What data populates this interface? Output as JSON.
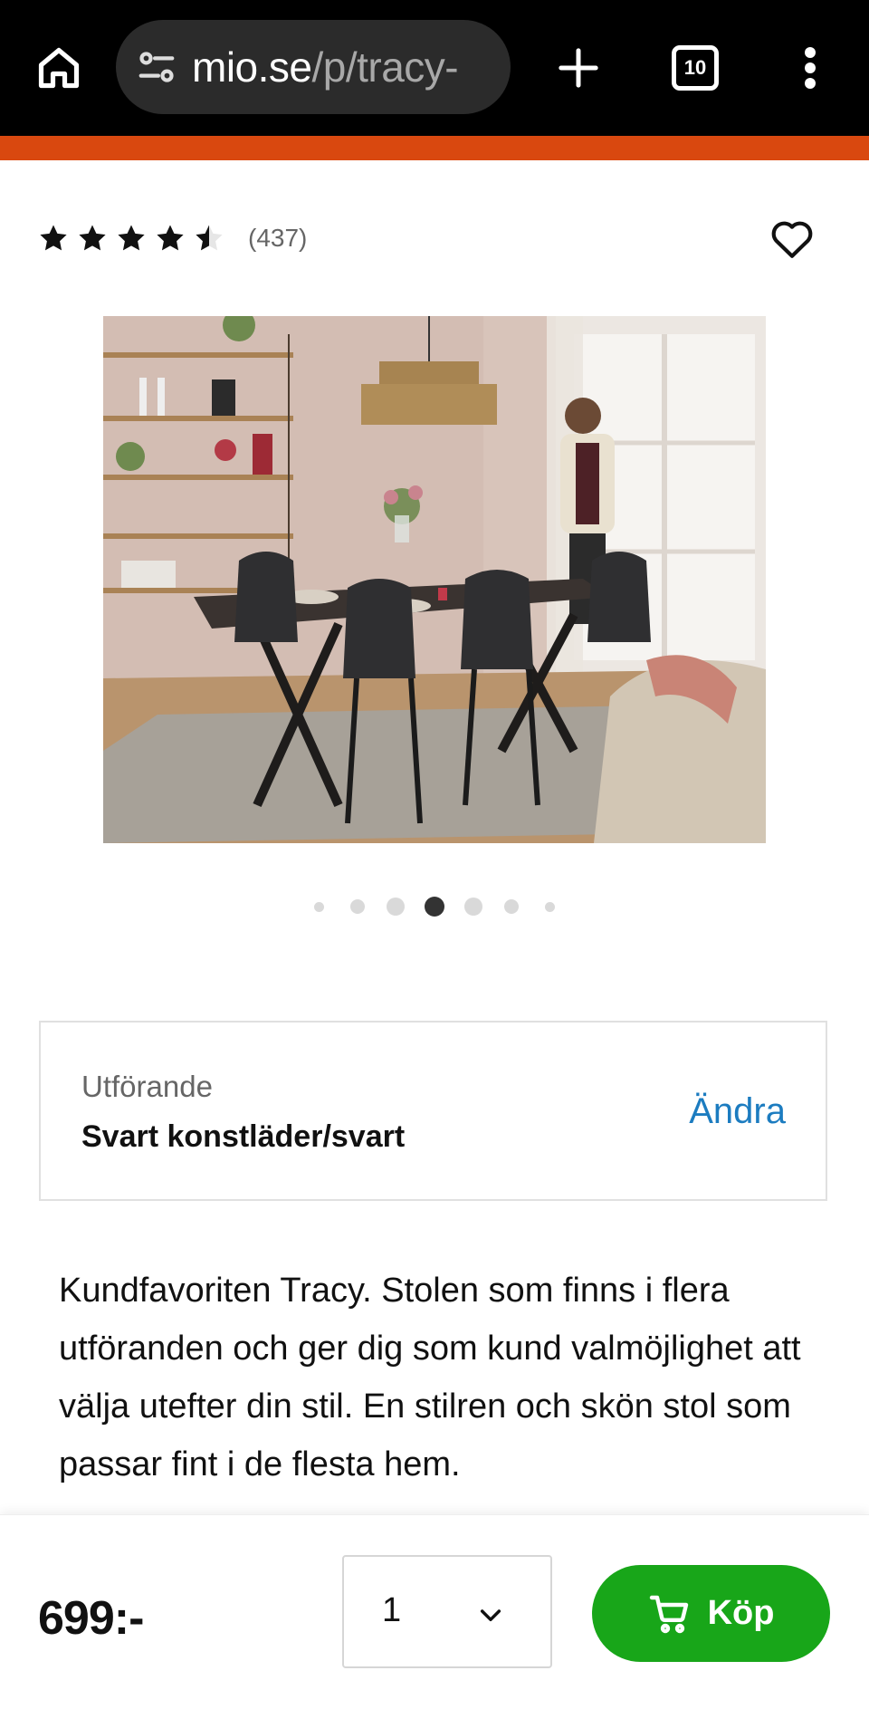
{
  "browser": {
    "url_host": "mio.se",
    "url_path": "/p/tracy-",
    "tab_count": "10"
  },
  "product": {
    "rating_value": 4.5,
    "rating_max": 5,
    "review_count": "(437)",
    "image_alt": "Tracy dining chairs around a dark table in a bright dining room",
    "carousel": {
      "total_dots": 7,
      "active_index": 3
    },
    "variant": {
      "label": "Utförande",
      "value": "Svart konstläder/svart",
      "change_label": "Ändra"
    },
    "description": "Kundfavoriten Tracy. Stolen som finns i flera utföranden och ger dig som kund valmöjlighet att välja utefter din stil. En stilren och skön stol som passar fint i de flesta hem."
  },
  "purchase": {
    "price": "699:-",
    "quantity": "1",
    "buy_label": "Köp"
  },
  "colors": {
    "brand_orange": "#d9480f",
    "buy_green": "#18a619",
    "link_blue": "#1c7cc0"
  },
  "icons": [
    "home-icon",
    "tune-icon",
    "plus-icon",
    "tabs-icon",
    "more-vert-icon",
    "star-icon",
    "heart-icon",
    "chevron-down-icon",
    "cart-icon"
  ]
}
